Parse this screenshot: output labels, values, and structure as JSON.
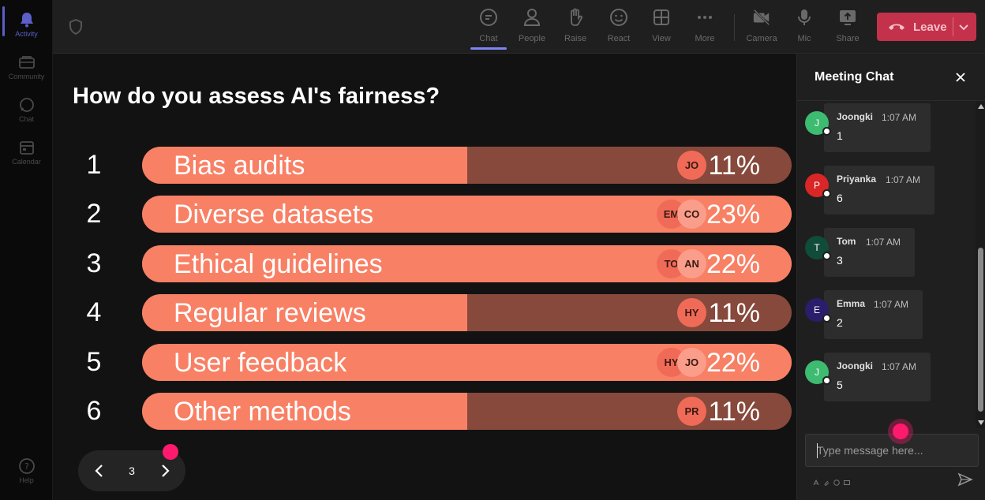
{
  "rail": {
    "items": [
      {
        "label": "Activity",
        "icon": "bell-icon"
      },
      {
        "label": "Community",
        "icon": "community-icon"
      },
      {
        "label": "Chat",
        "icon": "chat-icon"
      },
      {
        "label": "Calendar",
        "icon": "calendar-icon"
      }
    ],
    "help_label": "Help"
  },
  "toolbar": {
    "buttons": [
      {
        "label": "Chat",
        "icon": "chat-icon"
      },
      {
        "label": "People",
        "icon": "people-icon"
      },
      {
        "label": "Raise",
        "icon": "hand-icon"
      },
      {
        "label": "React",
        "icon": "smile-icon"
      },
      {
        "label": "View",
        "icon": "grid-icon"
      },
      {
        "label": "More",
        "icon": "more-icon"
      },
      {
        "label": "Camera",
        "icon": "camera-off-icon"
      },
      {
        "label": "Mic",
        "icon": "mic-icon"
      },
      {
        "label": "Share",
        "icon": "share-icon"
      }
    ],
    "leave_label": "Leave"
  },
  "poll": {
    "question": "How do you assess AI's fairness?",
    "options": [
      {
        "num": "1",
        "label": "Bias audits",
        "percent": "11%",
        "fraction": 0.11,
        "voters": [
          "JO"
        ]
      },
      {
        "num": "2",
        "label": "Diverse datasets",
        "percent": "23%",
        "fraction": 1.0,
        "voters": [
          "EM",
          "CO"
        ]
      },
      {
        "num": "3",
        "label": "Ethical guidelines",
        "percent": "22%",
        "fraction": 1.0,
        "voters": [
          "TO",
          "AN"
        ]
      },
      {
        "num": "4",
        "label": "Regular reviews",
        "percent": "11%",
        "fraction": 0.11,
        "voters": [
          "HY"
        ]
      },
      {
        "num": "5",
        "label": "User feedback",
        "percent": "22%",
        "fraction": 1.0,
        "voters": [
          "HY",
          "JO"
        ]
      },
      {
        "num": "6",
        "label": "Other methods",
        "percent": "11%",
        "fraction": 0.11,
        "voters": [
          "PR"
        ]
      }
    ],
    "page": "3"
  },
  "chat": {
    "title": "Meeting Chat",
    "messages": [
      {
        "initial": "J",
        "name": "Joongki",
        "time": "1:07 AM",
        "text": "1",
        "color": "#3dbb70"
      },
      {
        "initial": "P",
        "name": "Priyanka",
        "time": "1:07 AM",
        "text": "6",
        "color": "#d92626"
      },
      {
        "initial": "T",
        "name": "Tom",
        "time": "1:07 AM",
        "text": "3",
        "color": "#114b3a"
      },
      {
        "initial": "E",
        "name": "Emma",
        "time": "1:07 AM",
        "text": "2",
        "color": "#2a1d6b"
      },
      {
        "initial": "J",
        "name": "Joongki",
        "time": "1:07 AM",
        "text": "5",
        "color": "#3dbb70"
      }
    ],
    "placeholder": "Type message here..."
  },
  "colors": {
    "bar_fill": "#f88065",
    "bar_track": "#86493b",
    "leave": "#c4314b",
    "accent": "#5b5fc7",
    "highlight_dot": "#ff1a6e"
  }
}
